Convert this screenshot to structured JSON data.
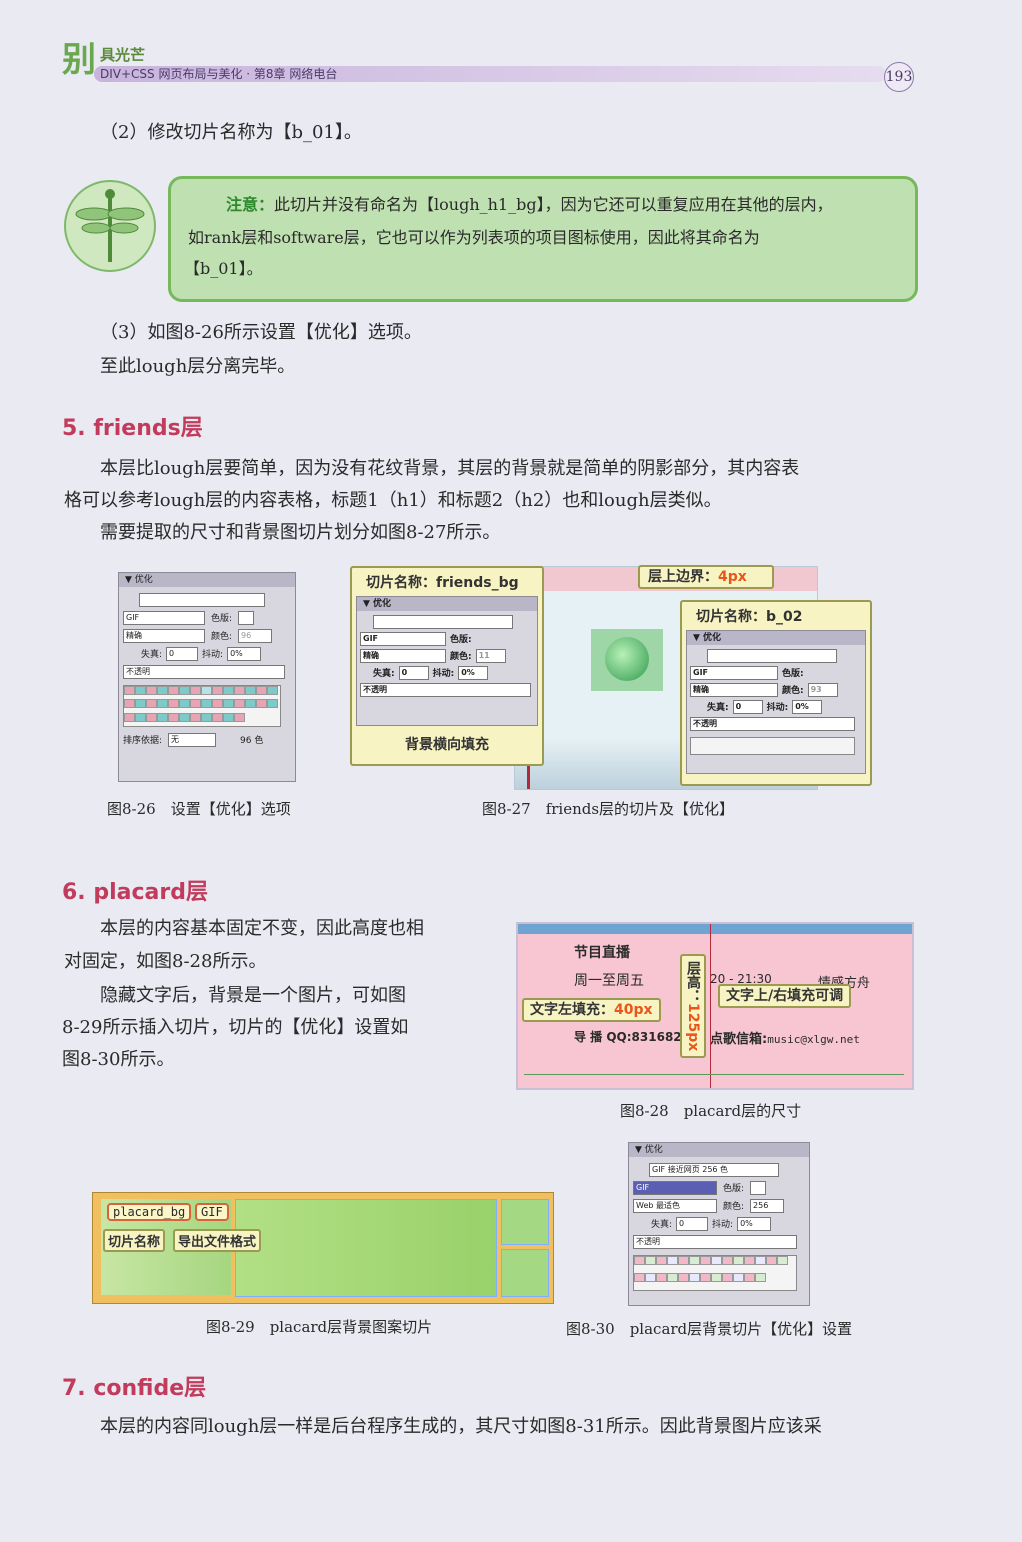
{
  "header": {
    "logo_big": "别",
    "logo_sub": "具光芒",
    "bar_text": "DIV+CSS 网页布局与美化 · 第8章   网络电台",
    "page_number": "193"
  },
  "paragraphs": {
    "p1": "（2）修改切片名称为【b_01】。",
    "note_label": "注意：",
    "note_l1": "此切片并没有命名为【lough_h1_bg】，因为它还可以重复应用在其他的层内，",
    "note_l2": "如rank层和software层，它也可以作为列表项的项目图标使用，因此将其命名为",
    "note_l3": "【b_01】。",
    "p2": "（3）如图8-26所示设置【优化】选项。",
    "p3": "至此lough层分离完毕。",
    "h5": "5. friends层",
    "p4": "本层比lough层要简单，因为没有花纹背景，其层的背景就是简单的阴影部分，其内容表",
    "p5": "格可以参考lough层的内容表格，标题1（h1）和标题2（h2）也和lough层类似。",
    "p6": "需要提取的尺寸和背景图切片划分如图8-27所示。",
    "h6": "6. placard层",
    "p7": "本层的内容基本固定不变，因此高度也相",
    "p8": "对固定，如图8-28所示。",
    "p9": "隐藏文字后，背景是一个图片，可如图",
    "p10": "8-29所示插入切片，切片的【优化】设置如",
    "p11": "图8-30所示。",
    "h7": "7. confide层",
    "p12": "本层的内容同lough层一样是后台程序生成的，其尺寸如图8-31所示。因此背景图片应该采"
  },
  "panels": {
    "title": "▼ 优化",
    "gif": "GIF",
    "precise": "精确",
    "color_table": "色版:",
    "colors": "颜色:",
    "loss": "失真:",
    "loss_val": "0",
    "dither": "抖动:",
    "dither_val": "0%",
    "opaque": "不透明",
    "sort": "排序依据:",
    "sort_val": "无",
    "count": "96 色",
    "web_palette": "GIF 接近网页 256 色",
    "web_adaptive": "Web 最适色",
    "colors_256": "256",
    "colors_11": "11",
    "colors_96": "96",
    "colors_93": "93"
  },
  "fig27": {
    "label1": "切片名称：friends_bg",
    "label2": "切片名称：b_02",
    "label3": "层上边界：",
    "label3_val": "4px",
    "label4": "背景横向填充"
  },
  "fig28": {
    "t1": "节目直播",
    "t2": "周一至周五",
    "t3": "20 - 21:30",
    "t4": "情感方舟",
    "t5": "导 播 QQ:8316820",
    "t6": "点歌信箱:",
    "t6b": "music@xlgw.net",
    "c1": "文字左填充：",
    "c1_val": "40px",
    "c2": "文字上/右填充可调",
    "c3": "层高：",
    "c3_val": "125px"
  },
  "fig29": {
    "tag1": "placard_bg",
    "tag2": "GIF",
    "c1": "切片名称",
    "c2": "导出文件格式"
  },
  "captions": {
    "f26": "图8-26　设置【优化】选项",
    "f27": "图8-27　friends层的切片及【优化】",
    "f28": "图8-28　placard层的尺寸",
    "f29": "图8-29　placard层背景图案切片",
    "f30": "图8-30　placard层背景切片【优化】设置"
  }
}
